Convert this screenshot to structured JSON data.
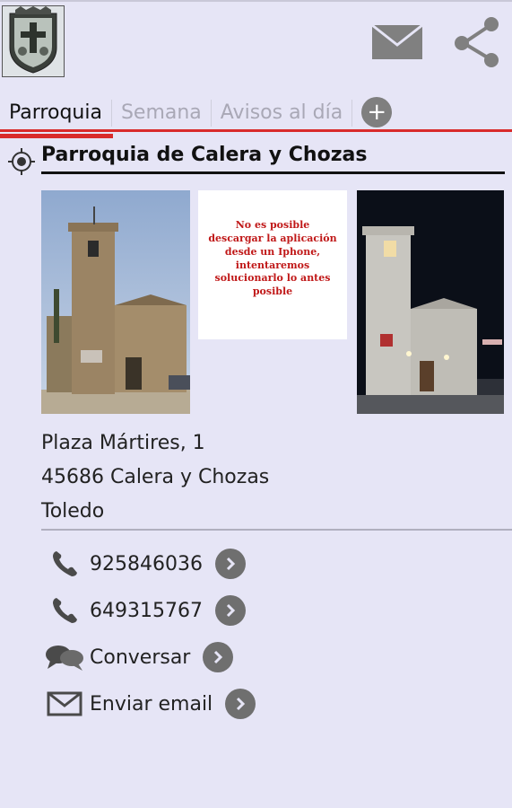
{
  "tabs": [
    {
      "label": "Parroquia"
    },
    {
      "label": "Semana"
    },
    {
      "label": "Avisos al día"
    }
  ],
  "main": {
    "title": "Parroquia de Calera y Chozas",
    "notice": "No es posible descargar la aplicación desde un Iphone, intentaremos solucionarlo lo antes posible",
    "address": {
      "line1": "Plaza Mártires, 1",
      "line2": "45686 Calera y Chozas",
      "line3": "Toledo"
    },
    "contacts": [
      {
        "label": "925846036",
        "icon": "phone-icon"
      },
      {
        "label": "649315767",
        "icon": "phone-icon"
      },
      {
        "label": "Conversar",
        "icon": "chat-icon"
      },
      {
        "label": "Enviar email",
        "icon": "mail-icon"
      }
    ]
  },
  "colors": {
    "accent": "#d92b2b",
    "background": "#e6e5f6",
    "icon_gray": "#7f7f7f"
  }
}
